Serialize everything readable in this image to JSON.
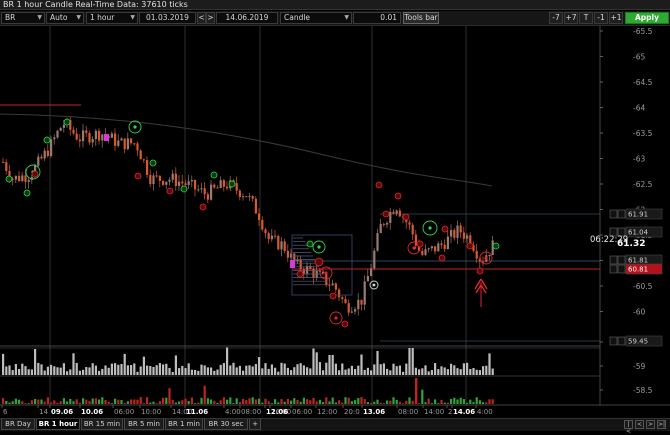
{
  "window": {
    "title": "BR 1 hour Candle Real-Time Data: 37610 ticks"
  },
  "toolbar": {
    "symbol": "BR",
    "scale_mode": "Auto",
    "period": "1 hour",
    "date_from": "01.03.2019",
    "prev_symbol": "<",
    "next_symbol": ">",
    "date_to": "14.06.2019",
    "chart_type": "Candle",
    "step_value": "0.01",
    "tools_bar_label": "Tools bar",
    "btn_minus7": "-7",
    "btn_plus7": "+7",
    "btn_t": "T",
    "btn_minus1": "-1",
    "btn_plus1": "+1",
    "apply_label": "Apply"
  },
  "price_axis": {
    "ticks": [
      "65.5",
      "65",
      "64.5",
      "64",
      "63.5",
      "63",
      "62.5",
      "62",
      "61.5",
      "61",
      "60.5",
      "60",
      "59.5",
      "59",
      "58.5"
    ],
    "boxes": [
      {
        "value": "61.91",
        "color": "#1a1a1a",
        "text_color": "#cccccc"
      },
      {
        "value": "61.04",
        "color": "#1a1a1a",
        "text_color": "#cccccc"
      },
      {
        "value": "61.81",
        "color": "#1a1a1a",
        "text_color": "#cccccc"
      },
      {
        "value": "60.81",
        "color": "#b3121a",
        "text_color": "#ffffff"
      },
      {
        "value": "59.45",
        "color": "#1a1a1a",
        "text_color": "#cccccc"
      }
    ],
    "last_price": "61.32",
    "countdown": "06:22:29"
  },
  "time_axis": {
    "labels": [
      {
        "text": "6",
        "date": false
      },
      {
        "text": "14",
        "date": false
      },
      {
        "text": "09.06",
        "date": true
      },
      {
        "text": "10.06",
        "date": true
      },
      {
        "text": "06:00",
        "date": false
      },
      {
        "text": "10:00",
        "date": false
      },
      {
        "text": "14:00",
        "date": false
      },
      {
        "text": "11.06",
        "date": true
      },
      {
        "text": "4:00",
        "date": false
      },
      {
        "text": "08:00",
        "date": false
      },
      {
        "text": "16:00",
        "date": false
      },
      {
        "text": "12.06",
        "date": true
      },
      {
        "text": "06:00",
        "date": false
      },
      {
        "text": "12:00",
        "date": false
      },
      {
        "text": "20:0",
        "date": false
      },
      {
        "text": "13.06",
        "date": true
      },
      {
        "text": "08:00",
        "date": false
      },
      {
        "text": "14:00",
        "date": false
      },
      {
        "text": "2",
        "date": false
      },
      {
        "text": "14.06",
        "date": true
      },
      {
        "text": "4:00",
        "date": false
      }
    ]
  },
  "colors": {
    "bull": "#9a7a72",
    "bear": "#d65a2e",
    "signal_red": "#e0262c",
    "signal_green": "#35d24a",
    "volume_bar": "#bdbdbd",
    "delta_up": "#2fa536",
    "delta_down": "#c0241e",
    "ma_line": "#3a3a3a",
    "level_red": "#c0242c"
  },
  "tabs": [
    {
      "label": "BR Day",
      "active": false
    },
    {
      "label": "BR 1 hour",
      "active": true
    },
    {
      "label": "BR 15 min",
      "active": false
    },
    {
      "label": "BR 5 min",
      "active": false
    },
    {
      "label": "BR 1 min",
      "active": false
    },
    {
      "label": "BR 30 sec",
      "active": false
    },
    {
      "label": "+",
      "active": false
    }
  ],
  "nav": {
    "first": "|<",
    "prev": "<",
    "next": ">",
    "last": ">|"
  }
}
